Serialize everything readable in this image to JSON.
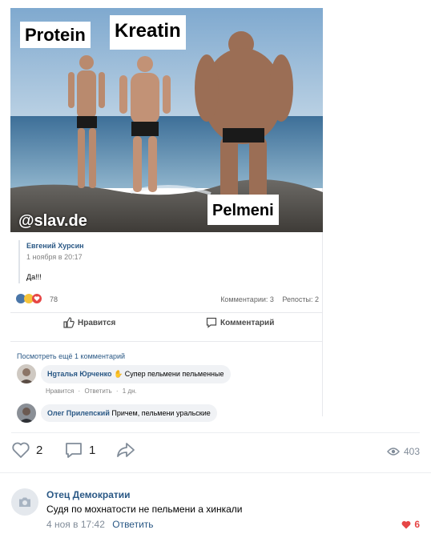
{
  "meme": {
    "label_protein": "Protein",
    "label_kreatin": "Kreatin",
    "label_pelmeni": "Pelmeni",
    "watermark": "@slav.de"
  },
  "repost": {
    "author": "Евгений Хурсин",
    "date": "1 ноября в 20:17",
    "text": "Да!!!"
  },
  "stats": {
    "reactions_count": "78",
    "comments": "Комментарии: 3",
    "reposts": "Репосты: 2"
  },
  "post_actions": {
    "like_label": "Нравится",
    "comment_label": "Комментарий"
  },
  "comments": {
    "more_link": "Посмотреть ещё 1 комментарий",
    "items": [
      {
        "author": "Нgталья Юрченко",
        "text": " Супер пельмени пельменные",
        "meta_like": "Нравится",
        "meta_reply": "Ответить",
        "meta_time": "1 дн."
      },
      {
        "author": "Олег Прилепский",
        "text": " Причем, пельмени уральские"
      }
    ]
  },
  "footer": {
    "likes": "2",
    "comments": "1",
    "views": "403"
  },
  "reply": {
    "author": "Отец Демократии",
    "text": "Судя по мохнатости не пельмени а хинкали",
    "date": "4 ноя в 17:42",
    "reply_link": "Ответить",
    "likes": "6"
  },
  "colors": {
    "link": "#2a5885",
    "muted": "#818c99",
    "like_red": "#e64646"
  },
  "icons": [
    "like-outline-icon",
    "comment-icon",
    "share-icon",
    "eye-icon",
    "camera-icon",
    "heart-filled-icon"
  ]
}
